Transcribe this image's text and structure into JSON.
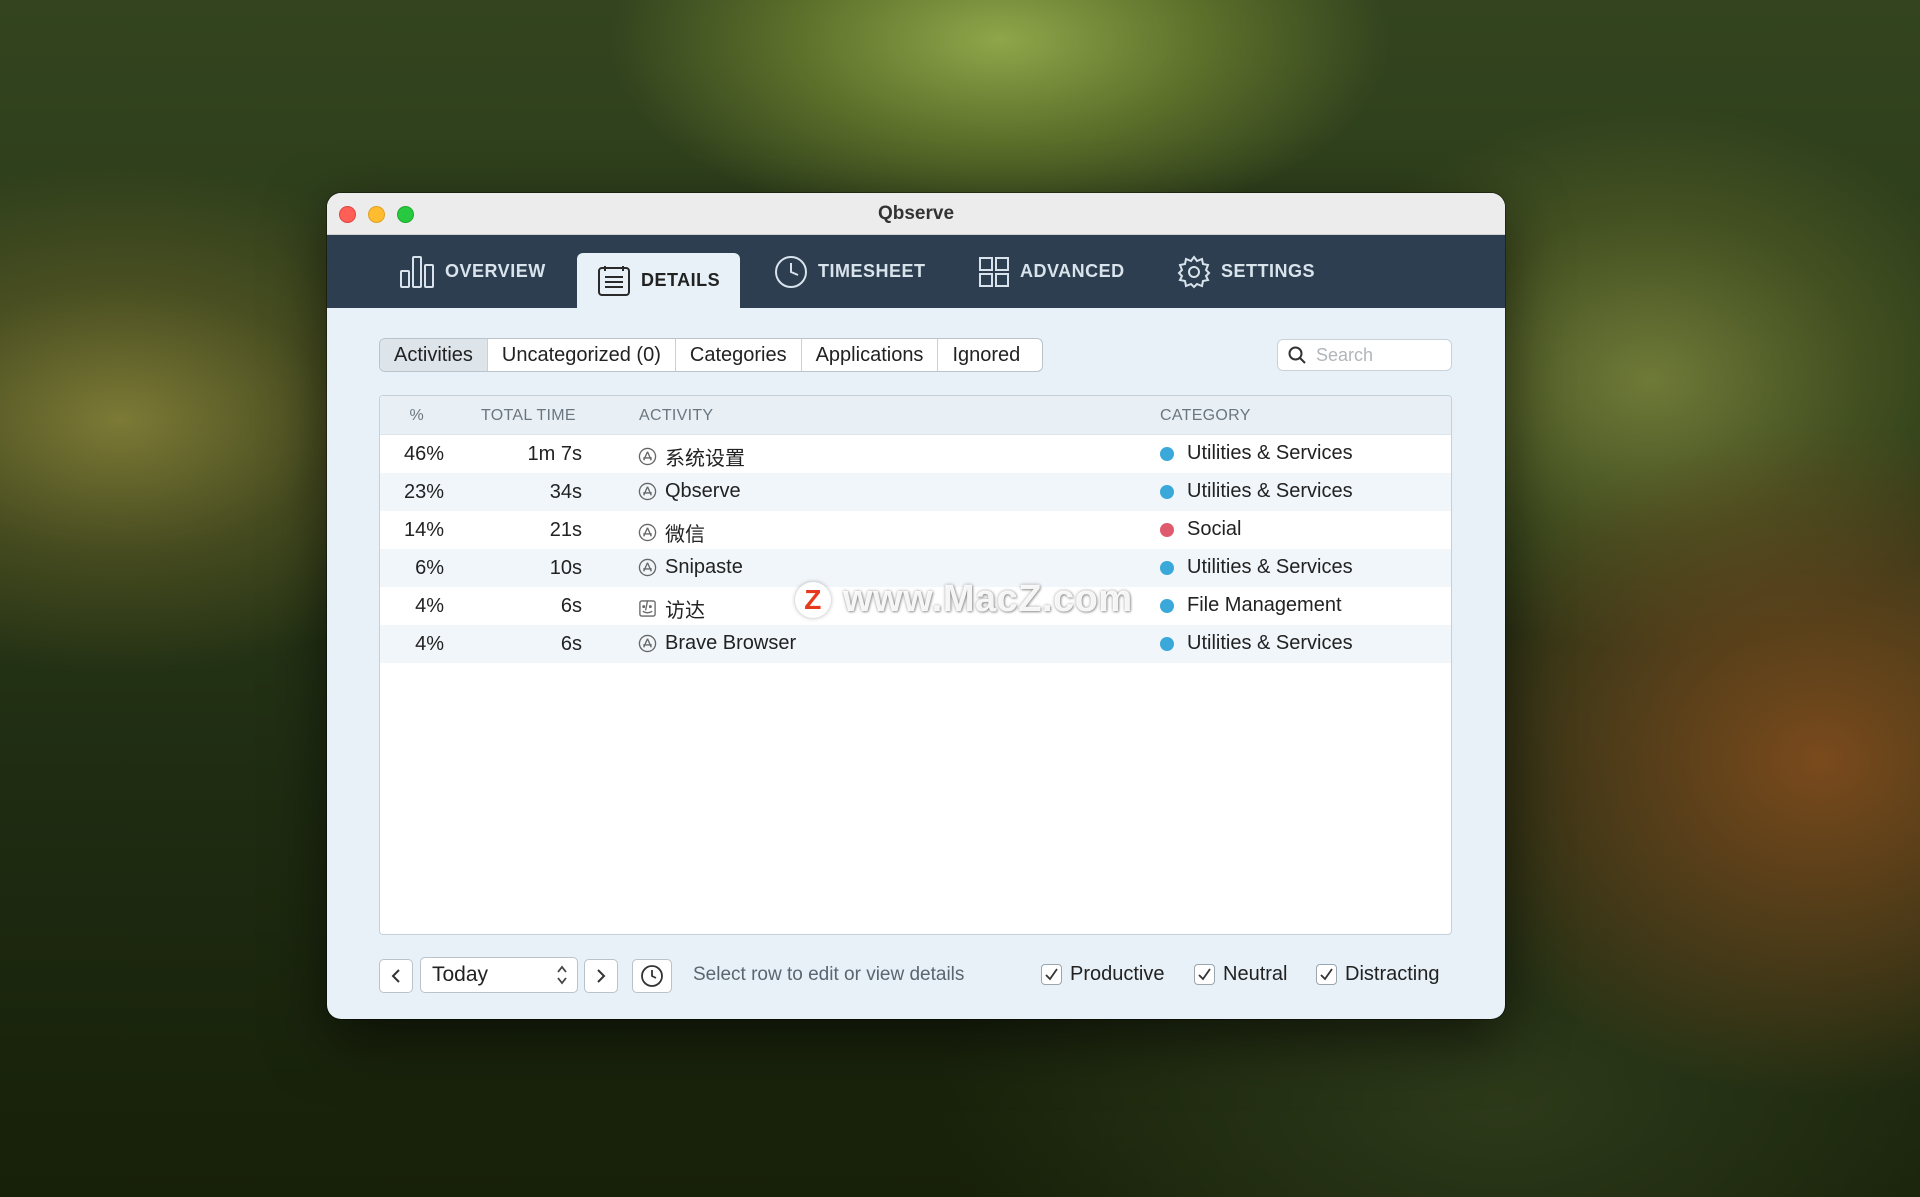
{
  "window": {
    "title": "Qbserve"
  },
  "nav": {
    "overview": "OVERVIEW",
    "details": "DETAILS",
    "timesheet": "TIMESHEET",
    "advanced": "ADVANCED",
    "settings": "SETTINGS"
  },
  "subtabs": [
    "Activities",
    "Uncategorized (0)",
    "Categories",
    "Applications",
    "Ignored"
  ],
  "search": {
    "placeholder": "Search"
  },
  "table": {
    "headers": {
      "pct": "%",
      "time": "TOTAL TIME",
      "activity": "ACTIVITY",
      "category": "CATEGORY"
    },
    "rows": [
      {
        "pct": "46%",
        "time": "1m 7s",
        "activity": "系统设置",
        "icon": "app-store-icon",
        "category": "Utilities & Services",
        "color": "#3aa8d8"
      },
      {
        "pct": "23%",
        "time": "34s",
        "activity": "Qbserve",
        "icon": "app-store-icon",
        "category": "Utilities & Services",
        "color": "#3aa8d8"
      },
      {
        "pct": "14%",
        "time": "21s",
        "activity": "微信",
        "icon": "app-store-icon",
        "category": "Social",
        "color": "#e05a6d"
      },
      {
        "pct": "6%",
        "time": "10s",
        "activity": "Snipaste",
        "icon": "app-store-icon",
        "category": "Utilities & Services",
        "color": "#3aa8d8"
      },
      {
        "pct": "4%",
        "time": "6s",
        "activity": "访达",
        "icon": "finder-icon",
        "category": "File Management",
        "color": "#3aa8d8"
      },
      {
        "pct": "4%",
        "time": "6s",
        "activity": "Brave Browser",
        "icon": "app-store-icon",
        "category": "Utilities & Services",
        "color": "#3aa8d8"
      }
    ]
  },
  "footer": {
    "date": "Today",
    "hint": "Select row to edit or view details",
    "productive": "Productive",
    "neutral": "Neutral",
    "distracting": "Distracting"
  },
  "watermark": {
    "logo": "Z",
    "text": "www.MacZ.com"
  }
}
